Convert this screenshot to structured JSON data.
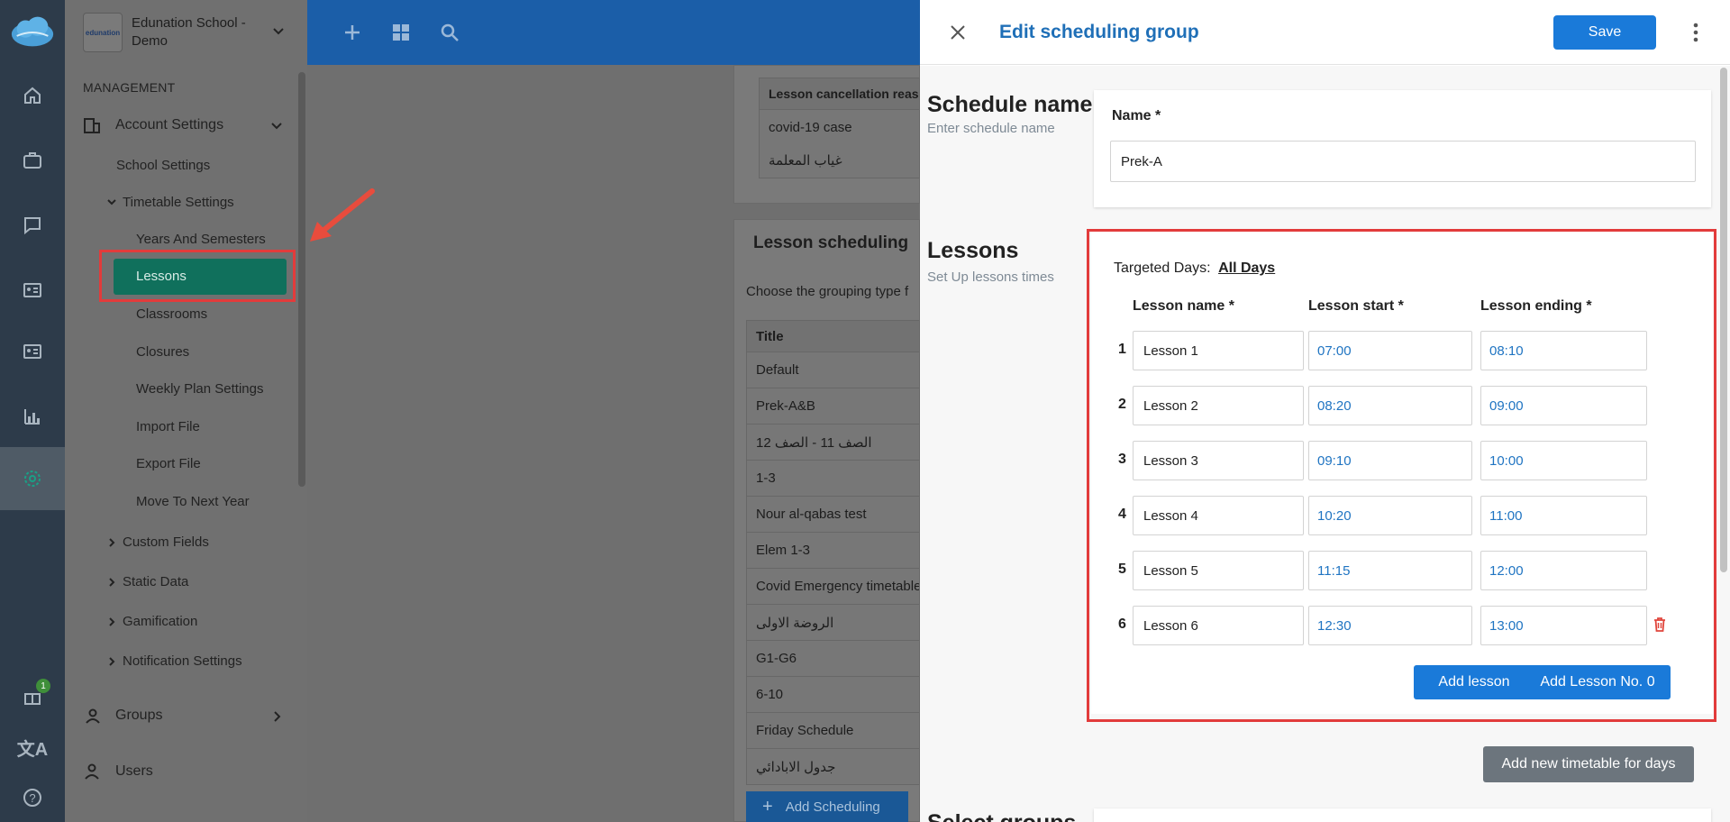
{
  "school": {
    "name": "Edunation School - Demo",
    "logo_text": "edunation"
  },
  "sidebar": {
    "section": "MANAGEMENT",
    "account_settings": "Account Settings",
    "school_settings": "School Settings",
    "timetable_settings": "Timetable Settings",
    "timetable_items": [
      "Years And Semesters",
      "Lessons",
      "Classrooms",
      "Closures",
      "Weekly Plan Settings",
      "Import File",
      "Export File",
      "Move To Next Year"
    ],
    "collapsed": [
      "Custom Fields",
      "Static Data",
      "Gamification",
      "Notification Settings"
    ],
    "groups": "Groups",
    "users": "Users"
  },
  "rail": {
    "gift_badge": "1"
  },
  "background": {
    "cancellation_header": "Lesson cancellation reas",
    "cancellation_rows": [
      "covid-19 case",
      "غياب المعلمة"
    ],
    "scheduling_title": "Lesson scheduling",
    "scheduling_desc": "Choose the grouping type f",
    "table_header": "Title",
    "rows": [
      "Default",
      "Prek-A&B",
      "الصف 11 - الصف 12",
      "1-3",
      "Nour al-qabas test",
      "Elem 1-3",
      "Covid Emergency timetable",
      "الروضة الاولى",
      "G1-G6",
      "6-10",
      "Friday Schedule",
      "جدول الابادائي"
    ],
    "add_button": "Add Scheduling"
  },
  "drawer": {
    "title": "Edit scheduling group",
    "save": "Save",
    "schedule_name": {
      "heading": "Schedule name",
      "sub": "Enter schedule name",
      "label": "Name *",
      "value": "Prek-A"
    },
    "lessons": {
      "heading": "Lessons",
      "sub": "Set Up lessons times",
      "targeted_label": "Targeted Days:",
      "targeted_value": "All Days",
      "col_name": "Lesson name *",
      "col_start": "Lesson start *",
      "col_end": "Lesson ending *",
      "rows": [
        {
          "n": "1",
          "name": "Lesson 1",
          "start": "07:00",
          "end": "08:10"
        },
        {
          "n": "2",
          "name": "Lesson 2",
          "start": "08:20",
          "end": "09:00"
        },
        {
          "n": "3",
          "name": "Lesson 3",
          "start": "09:10",
          "end": "10:00"
        },
        {
          "n": "4",
          "name": "Lesson 4",
          "start": "10:20",
          "end": "11:00"
        },
        {
          "n": "5",
          "name": "Lesson 5",
          "start": "11:15",
          "end": "12:00"
        },
        {
          "n": "6",
          "name": "Lesson 6",
          "start": "12:30",
          "end": "13:00"
        }
      ],
      "add_lesson": "Add lesson",
      "add_lesson_zero": "Add Lesson No. 0"
    },
    "add_timetable": "Add new timetable for days",
    "select_groups": "Select groups"
  }
}
